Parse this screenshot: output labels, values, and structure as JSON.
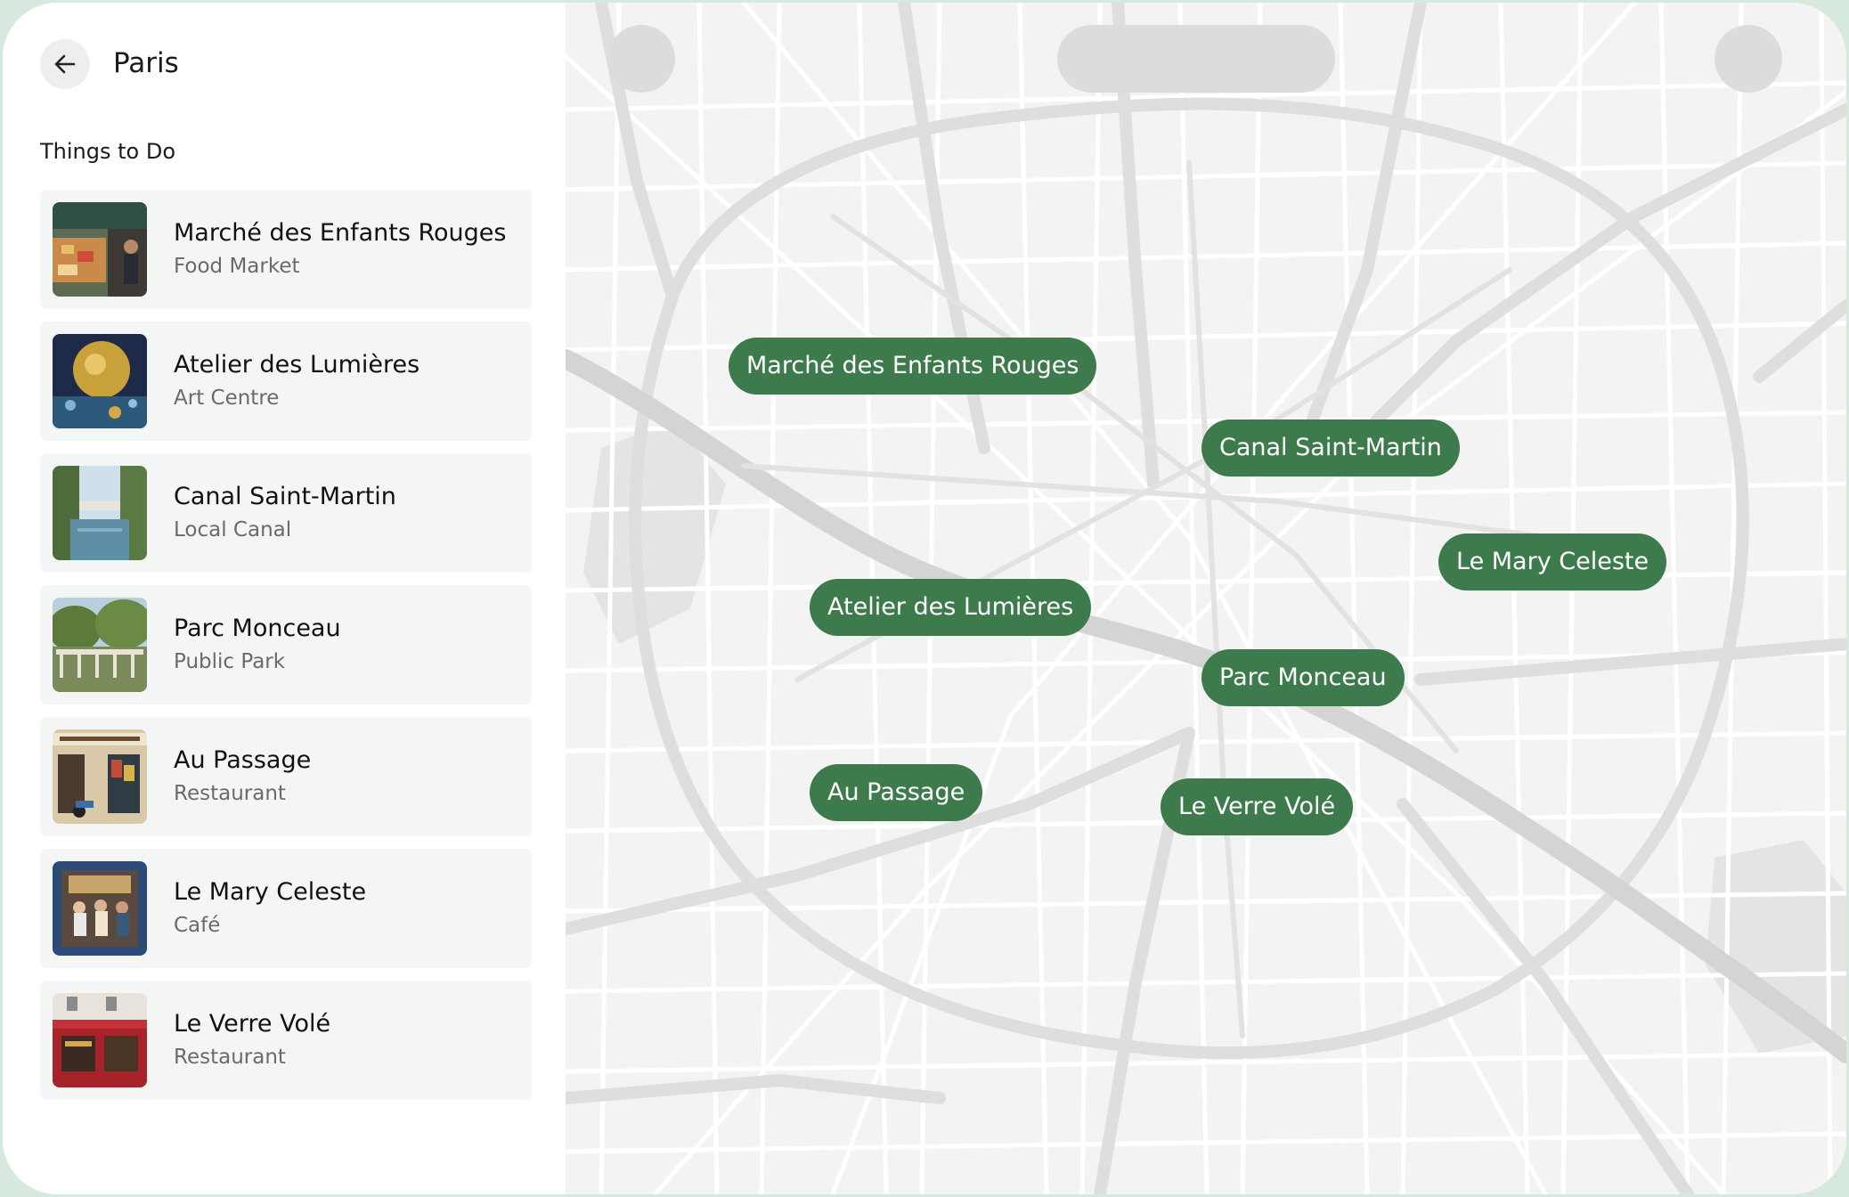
{
  "header": {
    "title": "Paris",
    "back_icon": "arrow-left-icon"
  },
  "section": {
    "heading": "Things to Do"
  },
  "places": [
    {
      "name": "Marché des Enfants Rouges",
      "category": "Food Market"
    },
    {
      "name": "Atelier des Lumières",
      "category": "Art Centre"
    },
    {
      "name": "Canal Saint-Martin",
      "category": "Local Canal"
    },
    {
      "name": "Parc Monceau",
      "category": "Public Park"
    },
    {
      "name": "Au Passage",
      "category": "Restaurant"
    },
    {
      "name": "Le Mary Celeste",
      "category": "Café"
    },
    {
      "name": "Le Verre Volé",
      "category": "Restaurant"
    }
  ],
  "map": {
    "pins": [
      {
        "label": "Marché des Enfants Rouges"
      },
      {
        "label": "Canal Saint-Martin"
      },
      {
        "label": "Le Mary Celeste"
      },
      {
        "label": "Atelier des Lumières"
      },
      {
        "label": "Parc Monceau"
      },
      {
        "label": "Au Passage"
      },
      {
        "label": "Le Verre Volé"
      }
    ]
  },
  "colors": {
    "pin_bg": "#3d7a4c",
    "card_bg": "#f4f5f5",
    "map_bg": "#f3f3f3",
    "frame": "#d6e9dc"
  }
}
